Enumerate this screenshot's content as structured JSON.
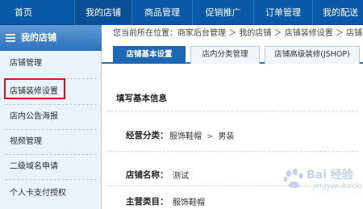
{
  "topnav": {
    "items": [
      {
        "label": "首页"
      },
      {
        "label": "我的店铺"
      },
      {
        "label": "商品管理"
      },
      {
        "label": "促销推广"
      },
      {
        "label": "订单管理"
      },
      {
        "label": "我的配送"
      }
    ],
    "active_index": 1
  },
  "sidebar": {
    "title": "我的店铺",
    "items": [
      {
        "label": "店铺管理"
      },
      {
        "label": "店铺装修设置"
      },
      {
        "label": "店内公告海报"
      },
      {
        "label": "视频管理"
      },
      {
        "label": "二级域名申请"
      },
      {
        "label": "个人卡支付授权"
      }
    ],
    "highlighted_index": 1
  },
  "breadcrumb": {
    "text": "您当前所在位置：商家后台管理 ＞ 我的店铺 ＞ 店铺装修设置 ＞ 店铺"
  },
  "tabs": [
    {
      "label": "店铺基本设置",
      "active": true
    },
    {
      "label": "店内分类管理",
      "active": false
    },
    {
      "label": "店铺高级装修(JSHOP)",
      "active": false
    }
  ],
  "form": {
    "section_title": "填写基本信息",
    "category": {
      "label": "经营分类：",
      "level1": "服饰鞋帽",
      "separator": ">",
      "level2": "男装"
    },
    "shop_name": {
      "label": "店铺名称：",
      "value": "测试"
    },
    "main_category": {
      "label": "主营类目：",
      "value": "服饰鞋帽"
    }
  },
  "watermark": {
    "text": "Bai 经验",
    "sub": "jingyan.baidu.com"
  },
  "colors": {
    "nav_bg": "#0a58a8",
    "tab_active": "#1f67b3",
    "highlight": "#d9121c",
    "sidebar_bg": "#eaf3fc"
  }
}
